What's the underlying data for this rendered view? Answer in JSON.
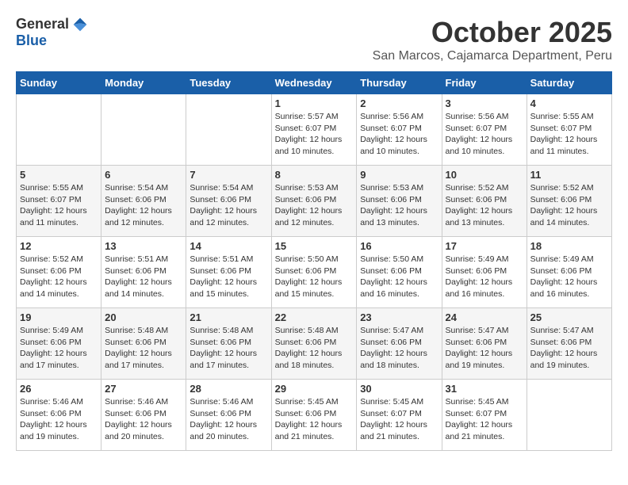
{
  "header": {
    "logo_general": "General",
    "logo_blue": "Blue",
    "month_title": "October 2025",
    "location": "San Marcos, Cajamarca Department, Peru"
  },
  "calendar": {
    "days_of_week": [
      "Sunday",
      "Monday",
      "Tuesday",
      "Wednesday",
      "Thursday",
      "Friday",
      "Saturday"
    ],
    "weeks": [
      [
        {
          "day": "",
          "info": ""
        },
        {
          "day": "",
          "info": ""
        },
        {
          "day": "",
          "info": ""
        },
        {
          "day": "1",
          "info": "Sunrise: 5:57 AM\nSunset: 6:07 PM\nDaylight: 12 hours and 10 minutes."
        },
        {
          "day": "2",
          "info": "Sunrise: 5:56 AM\nSunset: 6:07 PM\nDaylight: 12 hours and 10 minutes."
        },
        {
          "day": "3",
          "info": "Sunrise: 5:56 AM\nSunset: 6:07 PM\nDaylight: 12 hours and 10 minutes."
        },
        {
          "day": "4",
          "info": "Sunrise: 5:55 AM\nSunset: 6:07 PM\nDaylight: 12 hours and 11 minutes."
        }
      ],
      [
        {
          "day": "5",
          "info": "Sunrise: 5:55 AM\nSunset: 6:07 PM\nDaylight: 12 hours and 11 minutes."
        },
        {
          "day": "6",
          "info": "Sunrise: 5:54 AM\nSunset: 6:06 PM\nDaylight: 12 hours and 12 minutes."
        },
        {
          "day": "7",
          "info": "Sunrise: 5:54 AM\nSunset: 6:06 PM\nDaylight: 12 hours and 12 minutes."
        },
        {
          "day": "8",
          "info": "Sunrise: 5:53 AM\nSunset: 6:06 PM\nDaylight: 12 hours and 12 minutes."
        },
        {
          "day": "9",
          "info": "Sunrise: 5:53 AM\nSunset: 6:06 PM\nDaylight: 12 hours and 13 minutes."
        },
        {
          "day": "10",
          "info": "Sunrise: 5:52 AM\nSunset: 6:06 PM\nDaylight: 12 hours and 13 minutes."
        },
        {
          "day": "11",
          "info": "Sunrise: 5:52 AM\nSunset: 6:06 PM\nDaylight: 12 hours and 14 minutes."
        }
      ],
      [
        {
          "day": "12",
          "info": "Sunrise: 5:52 AM\nSunset: 6:06 PM\nDaylight: 12 hours and 14 minutes."
        },
        {
          "day": "13",
          "info": "Sunrise: 5:51 AM\nSunset: 6:06 PM\nDaylight: 12 hours and 14 minutes."
        },
        {
          "day": "14",
          "info": "Sunrise: 5:51 AM\nSunset: 6:06 PM\nDaylight: 12 hours and 15 minutes."
        },
        {
          "day": "15",
          "info": "Sunrise: 5:50 AM\nSunset: 6:06 PM\nDaylight: 12 hours and 15 minutes."
        },
        {
          "day": "16",
          "info": "Sunrise: 5:50 AM\nSunset: 6:06 PM\nDaylight: 12 hours and 16 minutes."
        },
        {
          "day": "17",
          "info": "Sunrise: 5:49 AM\nSunset: 6:06 PM\nDaylight: 12 hours and 16 minutes."
        },
        {
          "day": "18",
          "info": "Sunrise: 5:49 AM\nSunset: 6:06 PM\nDaylight: 12 hours and 16 minutes."
        }
      ],
      [
        {
          "day": "19",
          "info": "Sunrise: 5:49 AM\nSunset: 6:06 PM\nDaylight: 12 hours and 17 minutes."
        },
        {
          "day": "20",
          "info": "Sunrise: 5:48 AM\nSunset: 6:06 PM\nDaylight: 12 hours and 17 minutes."
        },
        {
          "day": "21",
          "info": "Sunrise: 5:48 AM\nSunset: 6:06 PM\nDaylight: 12 hours and 17 minutes."
        },
        {
          "day": "22",
          "info": "Sunrise: 5:48 AM\nSunset: 6:06 PM\nDaylight: 12 hours and 18 minutes."
        },
        {
          "day": "23",
          "info": "Sunrise: 5:47 AM\nSunset: 6:06 PM\nDaylight: 12 hours and 18 minutes."
        },
        {
          "day": "24",
          "info": "Sunrise: 5:47 AM\nSunset: 6:06 PM\nDaylight: 12 hours and 19 minutes."
        },
        {
          "day": "25",
          "info": "Sunrise: 5:47 AM\nSunset: 6:06 PM\nDaylight: 12 hours and 19 minutes."
        }
      ],
      [
        {
          "day": "26",
          "info": "Sunrise: 5:46 AM\nSunset: 6:06 PM\nDaylight: 12 hours and 19 minutes."
        },
        {
          "day": "27",
          "info": "Sunrise: 5:46 AM\nSunset: 6:06 PM\nDaylight: 12 hours and 20 minutes."
        },
        {
          "day": "28",
          "info": "Sunrise: 5:46 AM\nSunset: 6:06 PM\nDaylight: 12 hours and 20 minutes."
        },
        {
          "day": "29",
          "info": "Sunrise: 5:45 AM\nSunset: 6:06 PM\nDaylight: 12 hours and 21 minutes."
        },
        {
          "day": "30",
          "info": "Sunrise: 5:45 AM\nSunset: 6:07 PM\nDaylight: 12 hours and 21 minutes."
        },
        {
          "day": "31",
          "info": "Sunrise: 5:45 AM\nSunset: 6:07 PM\nDaylight: 12 hours and 21 minutes."
        },
        {
          "day": "",
          "info": ""
        }
      ]
    ]
  }
}
